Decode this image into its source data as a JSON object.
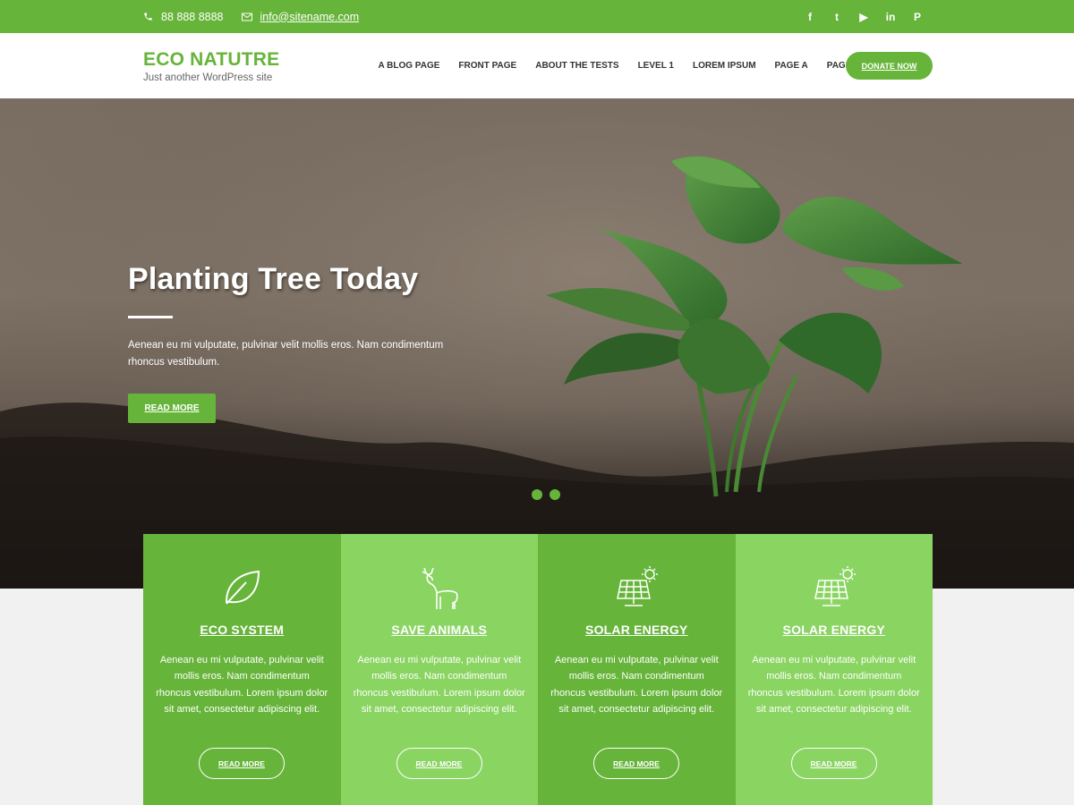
{
  "topbar": {
    "phone": "88 888 8888",
    "email": "info@sitename.com",
    "social": [
      {
        "icon": "facebook-icon",
        "glyph": "f"
      },
      {
        "icon": "twitter-icon",
        "glyph": "t"
      },
      {
        "icon": "youtube-icon",
        "glyph": "▶"
      },
      {
        "icon": "linkedin-icon",
        "glyph": "in"
      },
      {
        "icon": "pinterest-icon",
        "glyph": "P"
      }
    ]
  },
  "header": {
    "site_title": "ECO NATUTRE",
    "tagline": "Just another WordPress site",
    "nav": [
      "A BLOG PAGE",
      "FRONT PAGE",
      "ABOUT THE TESTS",
      "LEVEL 1",
      "LOREM IPSUM",
      "PAGE A",
      "PAGE B"
    ],
    "donate_label": "DONATE NOW"
  },
  "hero": {
    "title": "Planting Tree Today",
    "text": "Aenean eu mi vulputate, pulvinar velit mollis eros. Nam condimentum rhoncus vestibulum.",
    "button_label": "READ MORE",
    "slides": 2
  },
  "features": [
    {
      "icon": "leaf-icon",
      "title": "ECO SYSTEM",
      "text": "Aenean eu mi vulputate, pulvinar velit mollis eros. Nam condimentum rhoncus vestibulum. Lorem ipsum dolor sit amet, consectetur adipiscing elit.",
      "button": "READ MORE"
    },
    {
      "icon": "deer-icon",
      "title": "SAVE ANIMALS",
      "text": "Aenean eu mi vulputate, pulvinar velit mollis eros. Nam condimentum rhoncus vestibulum. Lorem ipsum dolor sit amet, consectetur adipiscing elit.",
      "button": "READ MORE"
    },
    {
      "icon": "solar-panel-icon",
      "title": "SOLAR ENERGY",
      "text": "Aenean eu mi vulputate, pulvinar velit mollis eros. Nam condimentum rhoncus vestibulum. Lorem ipsum dolor sit amet, consectetur adipiscing elit.",
      "button": "READ MORE"
    },
    {
      "icon": "solar-panel-icon",
      "title": "SOLAR ENERGY",
      "text": "Aenean eu mi vulputate, pulvinar velit mollis eros. Nam condimentum rhoncus vestibulum. Lorem ipsum dolor sit amet, consectetur adipiscing elit.",
      "button": "READ MORE"
    }
  ],
  "colors": {
    "accent": "#66b43a",
    "accent_light": "#8ad462"
  }
}
